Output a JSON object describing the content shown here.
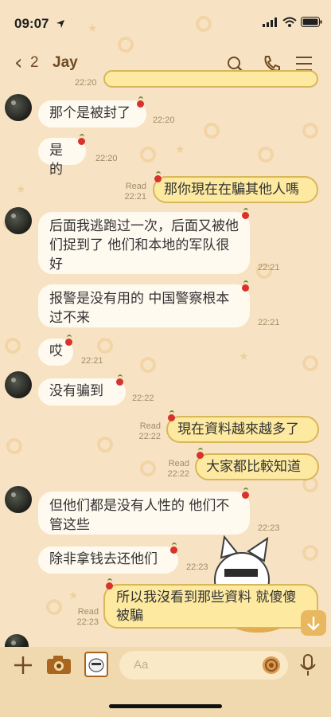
{
  "status_bar": {
    "time": "09:07"
  },
  "header": {
    "back_count": "2",
    "title": "Jay"
  },
  "messages": [
    {
      "text": "",
      "time": "22:20"
    },
    {
      "text": "那个是被封了",
      "time": "22:20"
    },
    {
      "text": "是的",
      "time": "22:20"
    },
    {
      "text": "那你現在在騙其他人嗎",
      "read": "Read",
      "time": "22:21"
    },
    {
      "text": "后面我逃跑过一次，后面又被他们捉到了 他们和本地的军队很好",
      "time": "22:21"
    },
    {
      "text": "报警是没有用的 中国警察根本过不来",
      "time": "22:21"
    },
    {
      "text": "哎",
      "time": "22:21"
    },
    {
      "text": "没有骗到",
      "time": "22:22"
    },
    {
      "text": "現在資料越來越多了",
      "read": "Read",
      "time": "22:22"
    },
    {
      "text": "大家都比較知道",
      "read": "Read",
      "time": "22:22"
    },
    {
      "text": "但他们都是没有人性的 他们不管这些",
      "time": "22:23"
    },
    {
      "text": "除非拿钱去还他们",
      "time": "22:23"
    },
    {
      "text": "所以我沒看到那些資料 就傻傻被騙",
      "read": "Read",
      "time": "22:23"
    }
  ],
  "input": {
    "placeholder": "Aa"
  },
  "icons": [
    "location-arrow-icon",
    "cellular-signal-icon",
    "wifi-icon",
    "battery-icon",
    "back-chevron-icon",
    "search-icon",
    "phone-icon",
    "menu-icon",
    "plus-icon",
    "camera-icon",
    "photo-icon",
    "emoji-icon",
    "mic-icon",
    "scroll-down-icon"
  ]
}
